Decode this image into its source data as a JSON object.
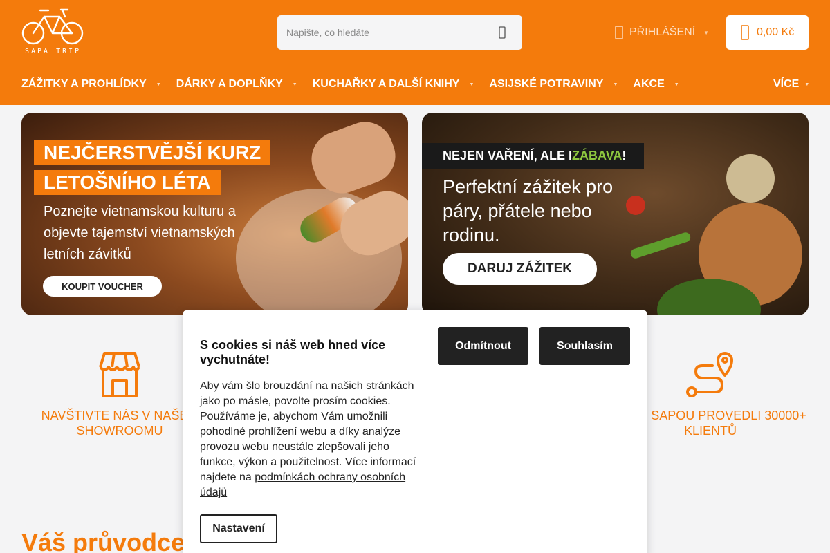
{
  "brand": {
    "logo_text": "SAPA TRIP",
    "accent_color": "#f47b0c"
  },
  "header": {
    "search_placeholder": "Napište, co hledáte",
    "search_icon": "search-icon",
    "login_label": "PŘIHLÁŠENÍ",
    "cart_total": "0,00 Kč"
  },
  "nav": {
    "items": [
      {
        "label": "ZÁŽITKY A PROHLÍDKY"
      },
      {
        "label": "DÁRKY A DOPLŇKY"
      },
      {
        "label": "KUCHAŘKY A DALŠÍ KNIHY"
      },
      {
        "label": "ASIJSKÉ POTRAVINY"
      },
      {
        "label": "AKCE"
      }
    ],
    "more_label": "VÍCE"
  },
  "banners": {
    "left": {
      "headline_1": "NEJČERSTVĚJŠÍ KURZ",
      "headline_2": "LETOŠNÍHO LÉTA",
      "body": "Poznejte vietnamskou kulturu a objevte tajemství vietnamských letních závitků",
      "button": "KOUPIT VOUCHER"
    },
    "right": {
      "bar_text": "NEJEN VAŘENÍ, ALE I ",
      "bar_highlight": "ZÁBAVA",
      "bar_end": "!",
      "body": "Perfektní zážitek pro páry, přátele nebo rodinu.",
      "button": "DARUJ ZÁŽITEK"
    }
  },
  "features": {
    "left": {
      "label": "NAVŠTIVTE NÁS V NAŠEM SHOWROOMU"
    },
    "right": {
      "label": "JSME SAPOU PROVEDLI 30000+ KLIENTŮ"
    }
  },
  "guide_title": "Váš průvodce",
  "cookie": {
    "title": "S cookies si náš web hned více vychutnáte!",
    "text": "Aby vám šlo brouzdání na našich stránkách jako po másle, povolte prosím cookies. Používáme je, abychom Vám umožnili pohodlné prohlížení webu a díky analýze provozu webu neustále zlepšovali jeho funkce, výkon a použitelnost. Více informací najdete na ",
    "link": "podmínkách ochrany osobních údajů",
    "reject": "Odmítnout",
    "accept": "Souhlasím",
    "settings": "Nastavení"
  }
}
